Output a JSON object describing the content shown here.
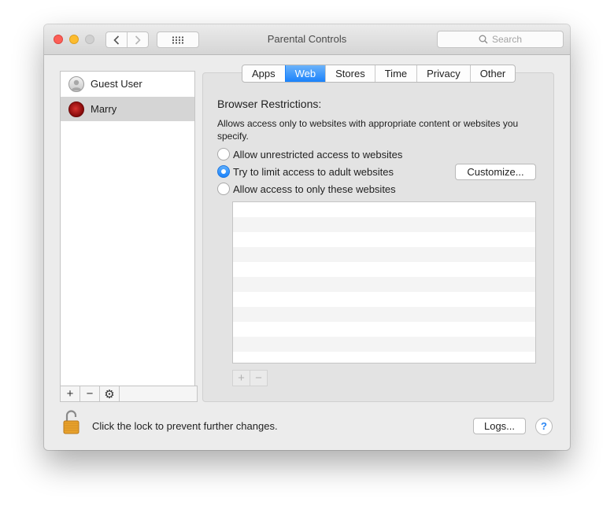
{
  "window": {
    "title": "Parental Controls"
  },
  "toolbar": {
    "back_icon": "chevron-left-icon",
    "forward_icon": "chevron-right-icon",
    "grid_icon": "grid-icon",
    "search_placeholder": "Search",
    "search_icon": "search-icon"
  },
  "sidebar": {
    "users": [
      {
        "name": "Guest User",
        "avatar": "guest-avatar",
        "selected": false
      },
      {
        "name": "Marry",
        "avatar": "flower-avatar",
        "selected": true
      }
    ],
    "tools": [
      "+",
      "−",
      "⚙"
    ]
  },
  "tabs": [
    {
      "label": "Apps",
      "active": false
    },
    {
      "label": "Web",
      "active": true
    },
    {
      "label": "Stores",
      "active": false
    },
    {
      "label": "Time",
      "active": false
    },
    {
      "label": "Privacy",
      "active": false
    },
    {
      "label": "Other",
      "active": false
    }
  ],
  "web": {
    "title": "Browser Restrictions:",
    "description": "Allows access only to websites with appropriate content or websites you specify.",
    "options": [
      {
        "label": "Allow unrestricted access to websites",
        "checked": false
      },
      {
        "label": "Try to limit access to adult websites",
        "checked": true
      },
      {
        "label": "Allow access to only these websites",
        "checked": false
      }
    ],
    "customize_label": "Customize...",
    "list_tools": [
      "+",
      "−"
    ]
  },
  "footer": {
    "lock_message": "Click the lock to prevent further changes.",
    "logs_label": "Logs...",
    "help_label": "?"
  },
  "colors": {
    "accent": "#1a82fb",
    "close": "#fc5f57",
    "minimize": "#fdbc2e",
    "lock": "#e8a22c"
  }
}
